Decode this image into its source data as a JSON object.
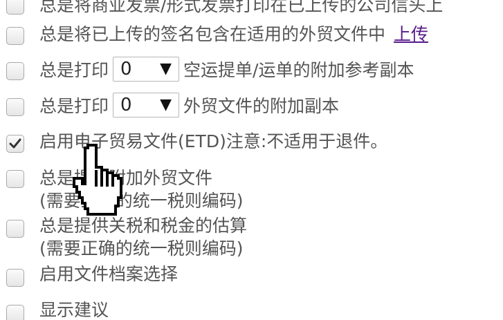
{
  "options": [
    {
      "text": "总是将商业发票/形式发票打印在已上传的公司信头上",
      "checked": false
    },
    {
      "text": "总是将已上传的签名包含在适用的外贸文件中",
      "link": "上传",
      "checked": false
    },
    {
      "prefix": "总是打印",
      "select_value": "0",
      "select_arrow": "▼",
      "suffix": "空运提单/运单的附加参考副本",
      "checked": false
    },
    {
      "prefix": "总是打印",
      "select_value": "0",
      "select_arrow": "▼",
      "suffix": "外贸文件的附加副本",
      "checked": false
    },
    {
      "text": "启用电子贸易文件(ETD)注意:不适用于退件。",
      "checked": true
    },
    {
      "line1": "总是提供附加外贸文件",
      "line2": "(需要正确的统一税则编码)",
      "checked": false
    },
    {
      "line1": "总是提供关税和税金的估算",
      "line2": "(需要正确的统一税则编码)",
      "checked": false
    },
    {
      "text": "启用文件档案选择",
      "checked": false
    },
    {
      "text": "显示建议",
      "checked": false
    }
  ],
  "colors": {
    "text": "#545454",
    "link": "#551a8b",
    "checkbox_border": "#a9a9a9"
  },
  "cursor_icon": "hand-pointer-icon"
}
